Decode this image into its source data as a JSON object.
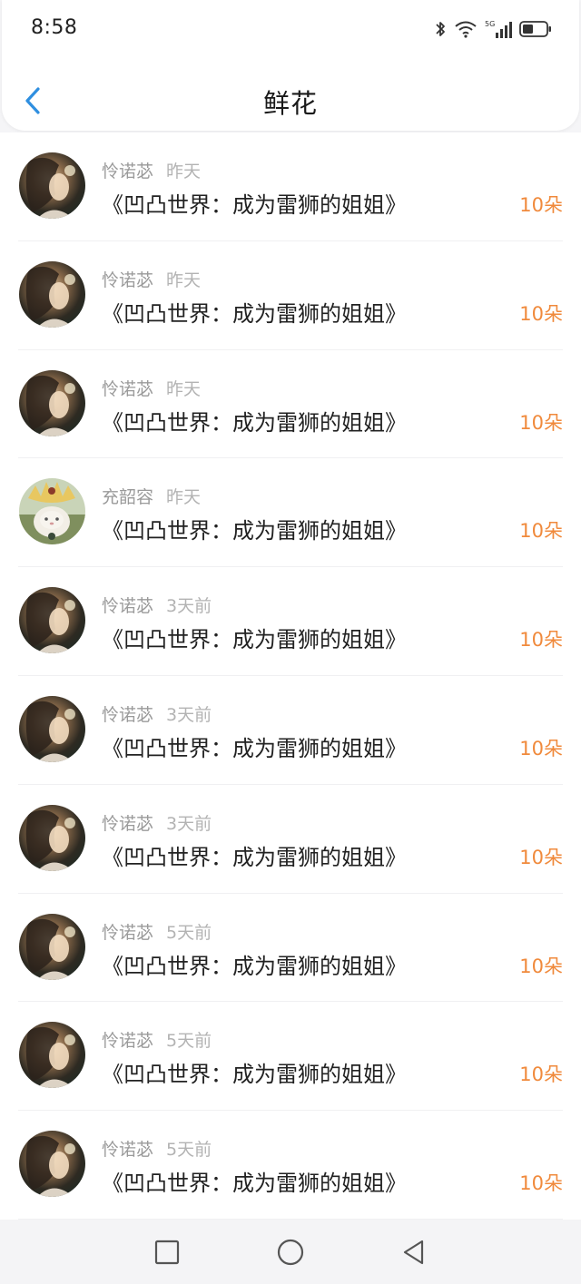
{
  "status_bar": {
    "time": "8:58",
    "icons": [
      "bluetooth-icon",
      "wifi-icon",
      "5g-signal-icon",
      "battery-icon"
    ]
  },
  "header": {
    "title": "鲜花",
    "back_icon": "chevron-left-icon"
  },
  "colors": {
    "accent": "#2f8fe0",
    "amount": "#f08a3c",
    "muted_text": "#9a9a9a",
    "primary_text": "#222222"
  },
  "records": [
    {
      "user": "怜诺苾",
      "time": "昨天",
      "book": "《凹凸世界：成为雷狮的姐姐》",
      "amount": "10朵",
      "avatar": "girl-avatar"
    },
    {
      "user": "怜诺苾",
      "time": "昨天",
      "book": "《凹凸世界：成为雷狮的姐姐》",
      "amount": "10朵",
      "avatar": "girl-avatar"
    },
    {
      "user": "怜诺苾",
      "time": "昨天",
      "book": "《凹凸世界：成为雷狮的姐姐》",
      "amount": "10朵",
      "avatar": "girl-avatar"
    },
    {
      "user": "充韶容",
      "time": "昨天",
      "book": "《凹凸世界：成为雷狮的姐姐》",
      "amount": "10朵",
      "avatar": "cat-avatar"
    },
    {
      "user": "怜诺苾",
      "time": "3天前",
      "book": "《凹凸世界：成为雷狮的姐姐》",
      "amount": "10朵",
      "avatar": "girl-avatar"
    },
    {
      "user": "怜诺苾",
      "time": "3天前",
      "book": "《凹凸世界：成为雷狮的姐姐》",
      "amount": "10朵",
      "avatar": "girl-avatar"
    },
    {
      "user": "怜诺苾",
      "time": "3天前",
      "book": "《凹凸世界：成为雷狮的姐姐》",
      "amount": "10朵",
      "avatar": "girl-avatar"
    },
    {
      "user": "怜诺苾",
      "time": "5天前",
      "book": "《凹凸世界：成为雷狮的姐姐》",
      "amount": "10朵",
      "avatar": "girl-avatar"
    },
    {
      "user": "怜诺苾",
      "time": "5天前",
      "book": "《凹凸世界：成为雷狮的姐姐》",
      "amount": "10朵",
      "avatar": "girl-avatar"
    },
    {
      "user": "怜诺苾",
      "time": "5天前",
      "book": "《凹凸世界：成为雷狮的姐姐》",
      "amount": "10朵",
      "avatar": "girl-avatar"
    }
  ],
  "system_nav": {
    "recent": "square-icon",
    "home": "circle-icon",
    "back": "triangle-back-icon"
  }
}
